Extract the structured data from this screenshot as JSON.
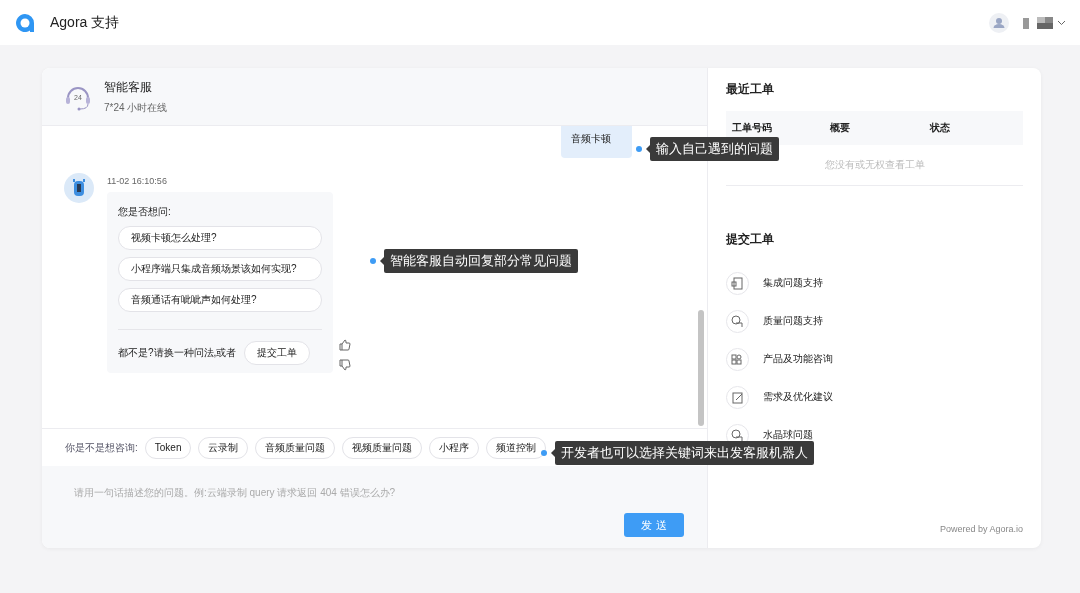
{
  "topbar": {
    "title": "Agora 支持"
  },
  "chat": {
    "header": {
      "badge": "24",
      "title": "智能客服",
      "subtitle": "7*24 小时在线"
    },
    "user_message": {
      "text": "音频卡顿"
    },
    "bot_message": {
      "time": "11-02 16:10:56",
      "prompt": "您是否想问:",
      "options": [
        "视频卡顿怎么处理?",
        "小程序端只集成音频场景该如何实现?",
        "音频通话有呲呲声如何处理?"
      ],
      "fallback": "都不是?请换一种问法,或者",
      "fallback_button": "提交工单"
    },
    "keywords": {
      "label": "你是不是想咨询:",
      "items": [
        "Token",
        "云录制",
        "音频质量问题",
        "视频质量问题",
        "小程序",
        "频道控制"
      ]
    },
    "input": {
      "placeholder": "请用一句话描述您的问题。例:云端录制 query 请求返回 404 错误怎么办?"
    },
    "send_button": "发 送"
  },
  "recent_tickets": {
    "title": "最近工单",
    "columns": [
      "工单号码",
      "概要",
      "状态"
    ],
    "empty": "您没有或无权查看工单"
  },
  "submit_ticket": {
    "title": "提交工单",
    "items": [
      {
        "kind": "integration",
        "label": "集成问题支持"
      },
      {
        "kind": "quality",
        "label": "质量问题支持"
      },
      {
        "kind": "product",
        "label": "产品及功能咨询"
      },
      {
        "kind": "suggestion",
        "label": "需求及优化建议"
      },
      {
        "kind": "quality",
        "label": "水晶球问题"
      }
    ]
  },
  "footer": "Powered by Agora.io",
  "annotations": [
    "输入自己遇到的问题",
    "智能客服自动回复部分常见问题",
    "开发者也可以选择关键词来出发客服机器人"
  ]
}
